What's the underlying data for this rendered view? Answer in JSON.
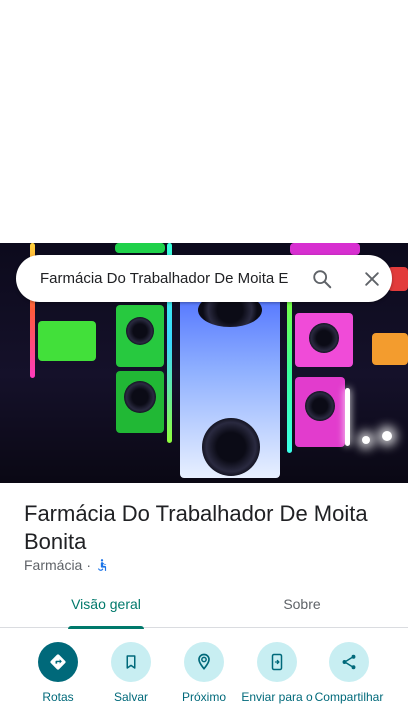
{
  "search": {
    "query": "Farmácia Do Trabalhador De Moita E"
  },
  "place": {
    "title": "Farmácia Do Trabalhador De Moita Bonita",
    "category": "Farmácia",
    "separator": "·"
  },
  "tabs": [
    {
      "label": "Visão geral",
      "active": true
    },
    {
      "label": "Sobre",
      "active": false
    }
  ],
  "actions": [
    {
      "label": "Rotas",
      "icon": "directions-icon"
    },
    {
      "label": "Salvar",
      "icon": "bookmark-icon"
    },
    {
      "label": "Próximo",
      "icon": "nearby-icon"
    },
    {
      "label": "Enviar para o",
      "icon": "send-to-phone-icon"
    },
    {
      "label": "Compartilhar",
      "icon": "share-icon"
    }
  ],
  "colors": {
    "accent": "#00796b",
    "action_primary_bg": "#00697a",
    "action_bg": "#c8eef2",
    "accessibility_icon": "#1a73e8"
  }
}
